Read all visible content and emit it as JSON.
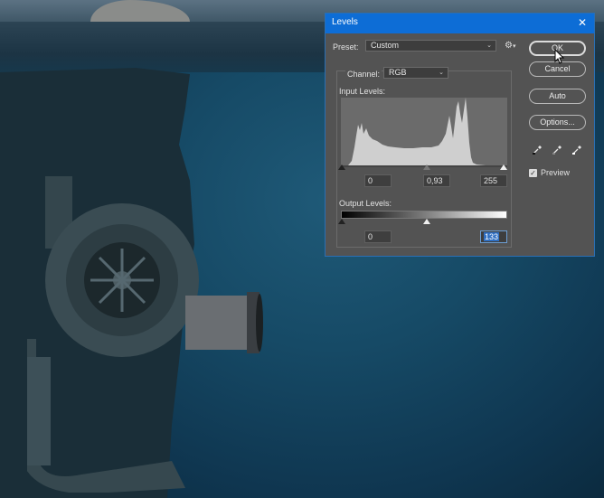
{
  "dialog": {
    "title": "Levels",
    "preset_label": "Preset:",
    "preset_value": "Custom",
    "channel_label": "Channel:",
    "channel_value": "RGB",
    "input_levels_label": "Input Levels:",
    "input_black": "0",
    "input_gamma": "0,93",
    "input_white": "255",
    "output_levels_label": "Output Levels:",
    "output_black": "0",
    "output_white": "133",
    "buttons": {
      "ok": "OK",
      "cancel": "Cancel",
      "auto": "Auto",
      "options": "Options..."
    },
    "preview_label": "Preview",
    "preview_checked": true
  },
  "icons": {
    "close": "close-icon",
    "gear": "gear-icon",
    "eyedroppers": [
      "black-point-eyedropper-icon",
      "gray-point-eyedropper-icon",
      "white-point-eyedropper-icon"
    ],
    "cursor": "mouse-pointer-icon"
  },
  "colors": {
    "titlebar": "#0d6dd6",
    "dialog_bg": "#535353",
    "selection": "#2f6fc2",
    "water": "#164a66"
  }
}
